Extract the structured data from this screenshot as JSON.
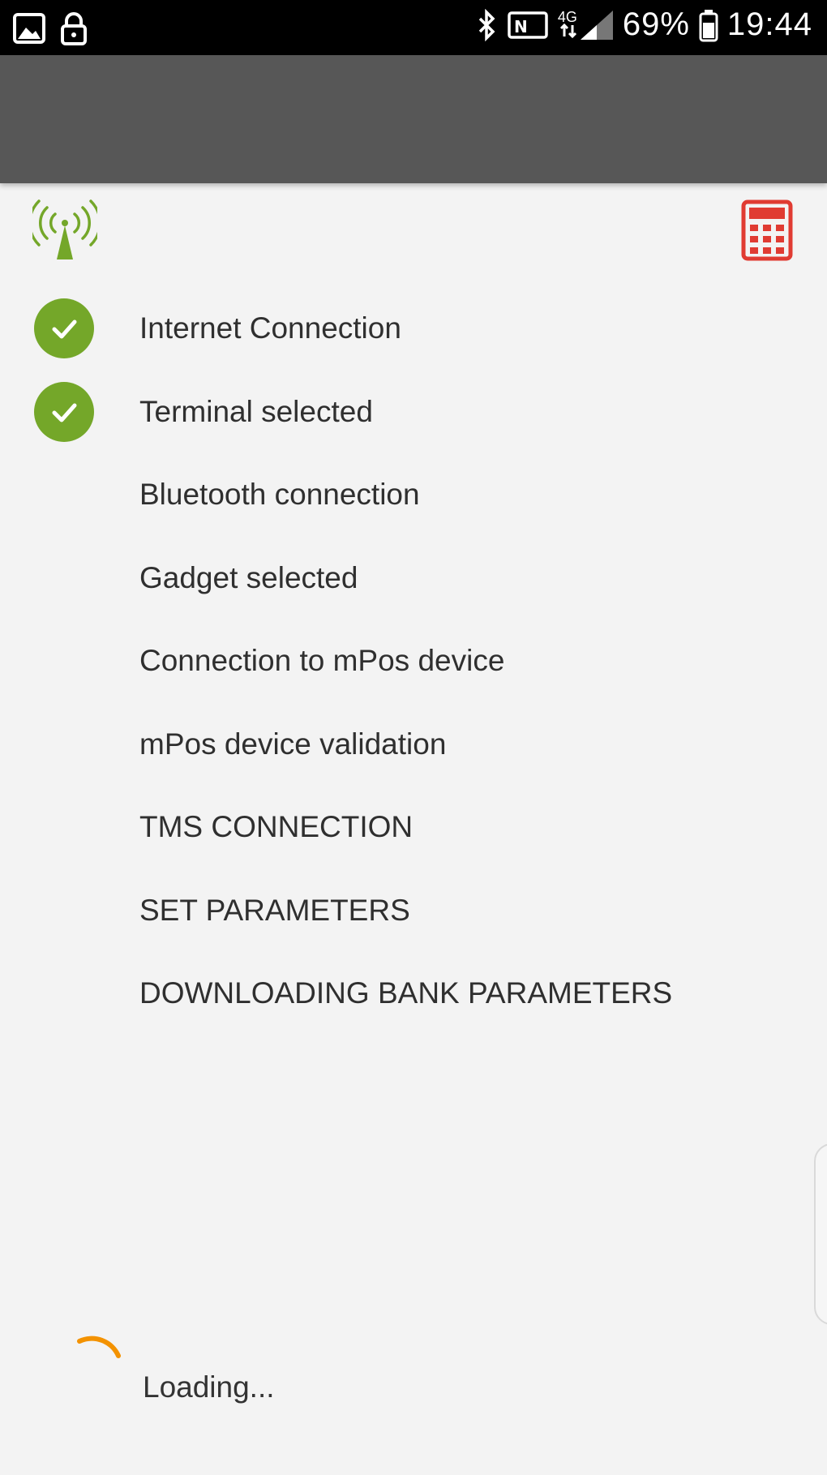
{
  "status_bar": {
    "battery_percent": "69%",
    "time": "19:44",
    "network_label": "4G",
    "icons": [
      "gallery-icon",
      "lock-icon",
      "bluetooth-icon",
      "nfc-icon",
      "data-arrows-icon",
      "signal-bars-icon",
      "battery-icon"
    ]
  },
  "header": {
    "left_icon": "broadcast-tower-icon",
    "right_icon": "calculator-icon",
    "accent_color": "#74a729",
    "calculator_color": "#e03b32"
  },
  "steps": [
    {
      "label": "Internet Connection",
      "completed": true
    },
    {
      "label": "Terminal selected",
      "completed": true
    },
    {
      "label": "Bluetooth connection",
      "completed": false
    },
    {
      "label": "Gadget selected",
      "completed": false
    },
    {
      "label": "Connection to mPos device",
      "completed": false
    },
    {
      "label": "mPos device validation",
      "completed": false
    },
    {
      "label": "TMS CONNECTION",
      "completed": false
    },
    {
      "label": "SET PARAMETERS",
      "completed": false
    },
    {
      "label": "DOWNLOADING BANK PARAMETERS",
      "completed": false
    }
  ],
  "loading": {
    "text": "Loading...",
    "spinner_color": "#f39200"
  }
}
